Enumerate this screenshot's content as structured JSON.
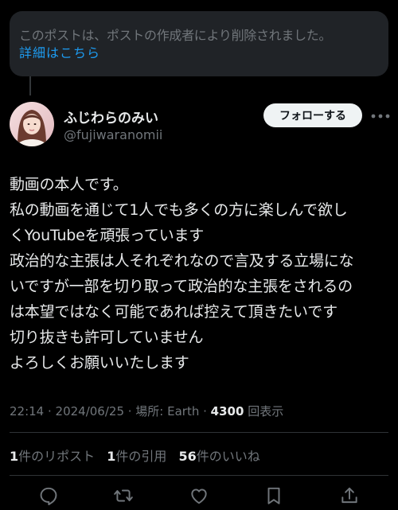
{
  "deleted_notice": {
    "text": "このポストは、ポストの作成者により削除されました。",
    "link": "詳細はこちら"
  },
  "author": {
    "name": "ふじわらのみい",
    "handle": "@fujiwaranomii",
    "avatar_icon": "profile-photo"
  },
  "follow_button": {
    "label": "フォローする"
  },
  "post": {
    "lines": [
      "動画の本人です。",
      "私の動画を通じて1人でも多くの方に楽しんで欲し",
      "くYouTubeを頑張っています",
      "政治的な主張は人それぞれなので言及する立場にな",
      "いですが一部を切り取って政治的な主張をされるの",
      "は本望ではなく可能であれば控えて頂きたいです",
      "切り抜きも許可していません",
      "よろしくお願いいたします"
    ]
  },
  "meta": {
    "time_date_location": "22:14 · 2024/06/25 · 場所: Earth · ",
    "views": "4300",
    "views_label": "回表示"
  },
  "stats": {
    "reposts": "1",
    "reposts_label": "件のリポスト",
    "quotes": "1",
    "quotes_label": "件の引用",
    "likes": "56",
    "likes_label": "件のいいね"
  },
  "actions": [
    "reply-icon",
    "repost-icon",
    "like-icon",
    "bookmark-icon",
    "share-icon"
  ],
  "colors": {
    "background": "#000000",
    "link_blue": "#1d9bf0",
    "text_primary": "#e7e9ea",
    "text_secondary": "#71767b",
    "deleted_box_bg": "#202327",
    "follow_button_bg": "#eff3f4"
  }
}
